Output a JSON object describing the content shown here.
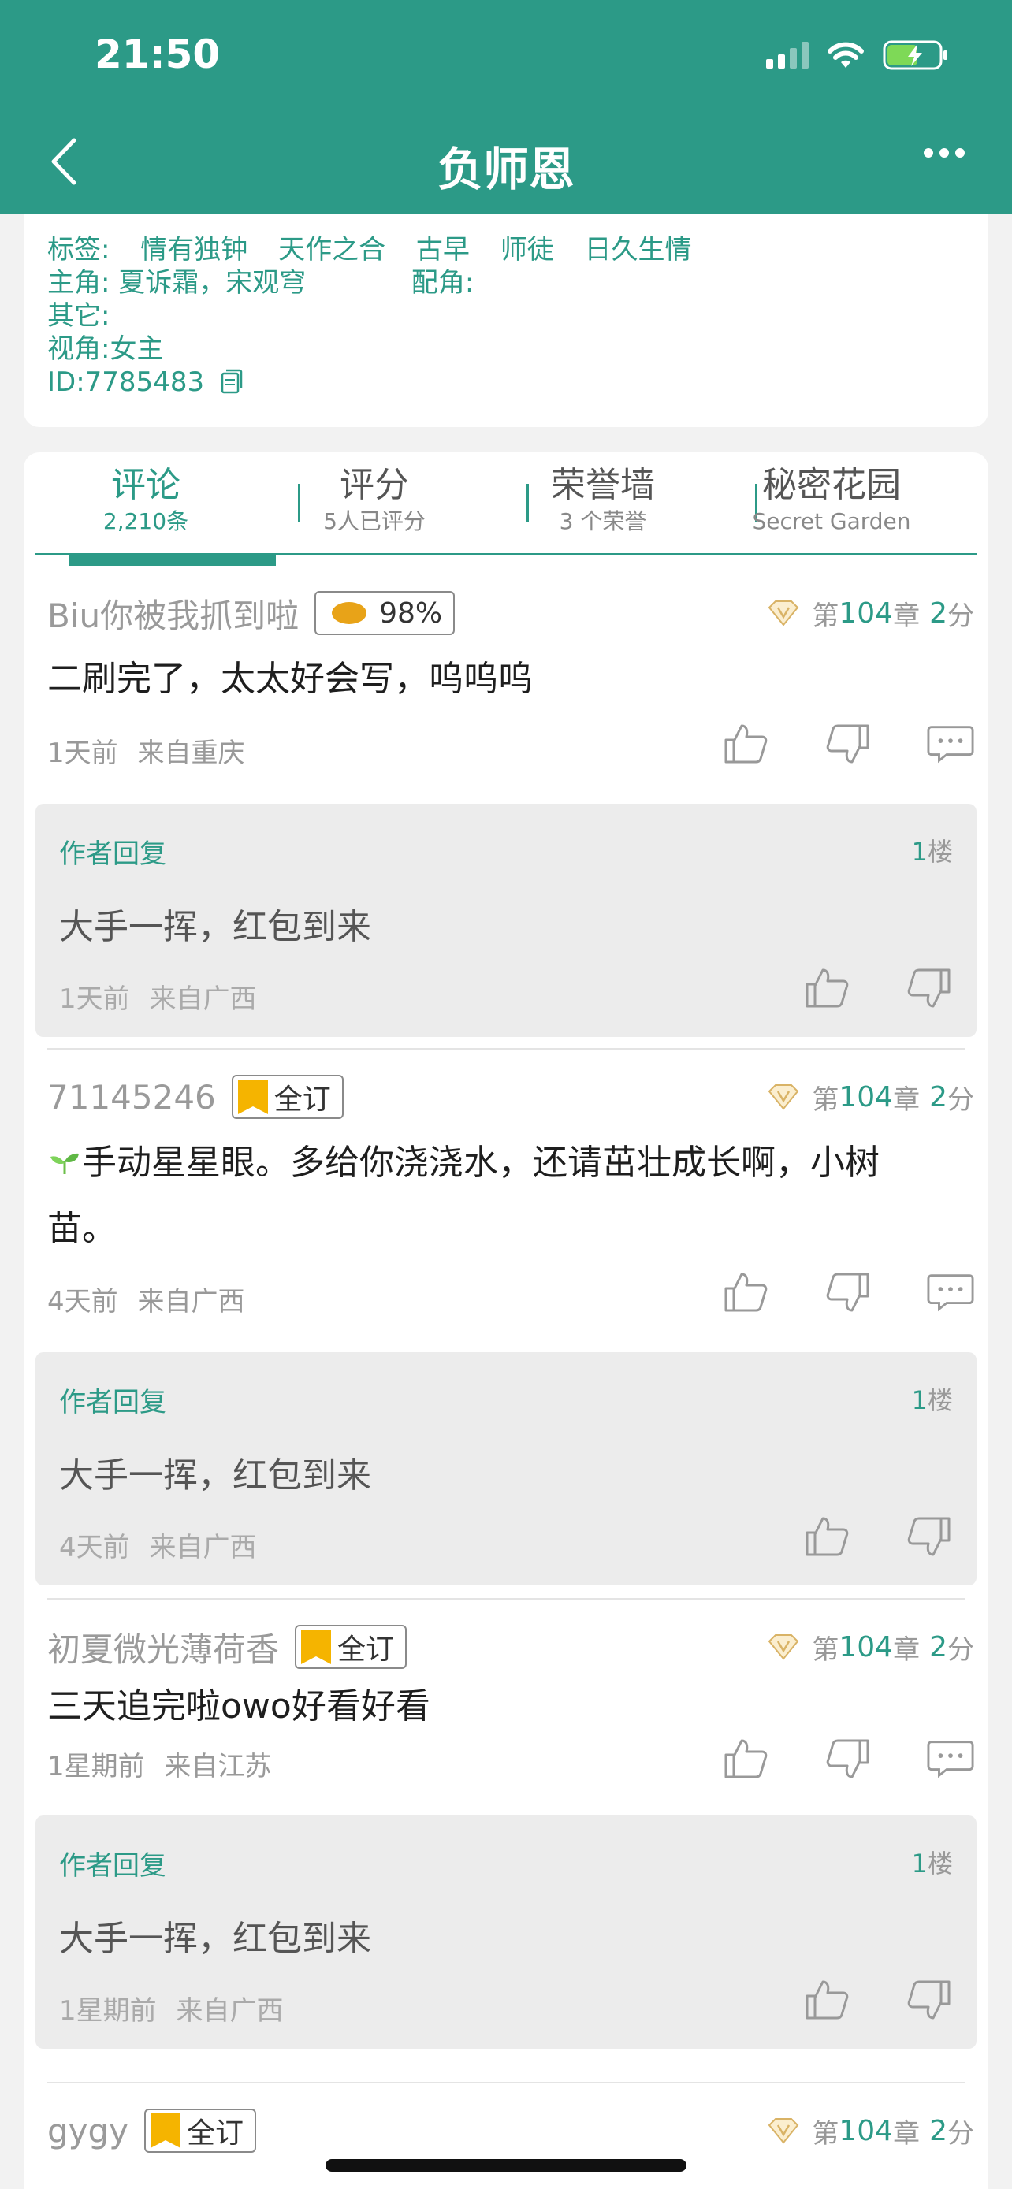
{
  "status": {
    "time": "21:50"
  },
  "header": {
    "title": "负师恩"
  },
  "info": {
    "tags_label": "标签:",
    "tags": [
      "情有独钟",
      "天作之合",
      "古早",
      "师徒",
      "日久生情"
    ],
    "main_roles_label": "主角:",
    "main_roles": "夏诉霜，宋观穹",
    "support_label": "配角:",
    "other_label": "其它:",
    "perspective": "视角:女主",
    "id": "ID:7785483"
  },
  "tabs": [
    {
      "label": "评论",
      "sub": "2,210条"
    },
    {
      "label": "评分",
      "sub": "5人已评分"
    },
    {
      "label": "荣誉墙",
      "sub": "3 个荣誉"
    },
    {
      "label": "秘密花园",
      "sub": "Secret Garden"
    }
  ],
  "comments": [
    {
      "user": "Biu你被我抓到啦",
      "badge": "98%",
      "chapter_prefix": "第",
      "chapter": "104",
      "chapter_suffix": "章",
      "score": "2",
      "score_suffix": "分",
      "text": "二刷完了，太太好会写，呜呜呜",
      "time": "1天前",
      "location": "来自重庆",
      "reply": {
        "label": "作者回复",
        "floor_num": "1",
        "floor_suffix": "楼",
        "text": "大手一挥，红包到来",
        "time": "1天前",
        "location": "来自广西"
      }
    },
    {
      "user": "71145246",
      "badge": "全订",
      "chapter_prefix": "第",
      "chapter": "104",
      "chapter_suffix": "章",
      "score": "2",
      "score_suffix": "分",
      "text_line1": "手动星星眼。多给你浇浇水，还请茁壮成长啊，小树",
      "text_line2": "苗。",
      "time": "4天前",
      "location": "来自广西",
      "reply": {
        "label": "作者回复",
        "floor_num": "1",
        "floor_suffix": "楼",
        "text": "大手一挥，红包到来",
        "time": "4天前",
        "location": "来自广西"
      }
    },
    {
      "user": "初夏微光薄荷香",
      "badge": "全订",
      "chapter_prefix": "第",
      "chapter": "104",
      "chapter_suffix": "章",
      "score": "2",
      "score_suffix": "分",
      "text": "三天追完啦owo好看好看",
      "time": "1星期前",
      "location": "来自江苏",
      "reply": {
        "label": "作者回复",
        "floor_num": "1",
        "floor_suffix": "楼",
        "text": "大手一挥，红包到来",
        "time": "1星期前",
        "location": "来自广西"
      }
    },
    {
      "user": "gygy",
      "badge": "全订",
      "chapter_prefix": "第",
      "chapter": "104",
      "chapter_suffix": "章",
      "score": "2",
      "score_suffix": "分"
    }
  ],
  "colors": {
    "accent": "#2c9a87",
    "reply_bg": "#ececec",
    "badge_gold": "#f5b400"
  }
}
